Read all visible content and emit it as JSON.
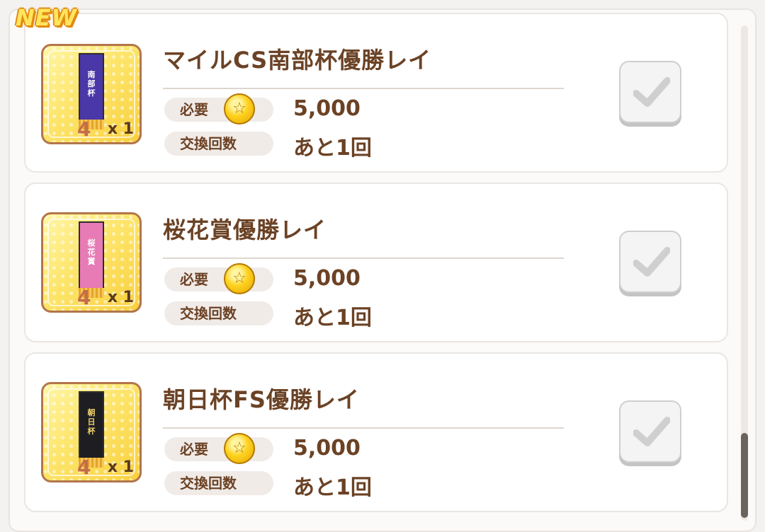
{
  "badge": "NEW",
  "labels": {
    "required": "必要",
    "exchange_count": "交換回数"
  },
  "items": [
    {
      "name": "マイルCS南部杯優勝レイ",
      "quantity": "x 1",
      "cost": "5,000",
      "remaining": "あと1回",
      "banner_text": "南部杯",
      "banner_color": "#4a37a8",
      "icon": "mile-cs-nanbuhai-lei-icon"
    },
    {
      "name": "桜花賞優勝レイ",
      "quantity": "x 1",
      "cost": "5,000",
      "remaining": "あと1回",
      "banner_text": "桜花賞",
      "banner_color": "#e77bb5",
      "icon": "oka-sho-lei-icon"
    },
    {
      "name": "朝日杯FS優勝レイ",
      "quantity": "x 1",
      "cost": "5,000",
      "remaining": "あと1回",
      "banner_text": "朝日杯",
      "banner_color": "#1d1d22",
      "icon": "asahi-hai-fs-lei-icon"
    }
  ],
  "colors": {
    "title_brown": "#6b4225",
    "coin_gold": "#ffd21f",
    "check_grey": "#c4c4c4"
  }
}
